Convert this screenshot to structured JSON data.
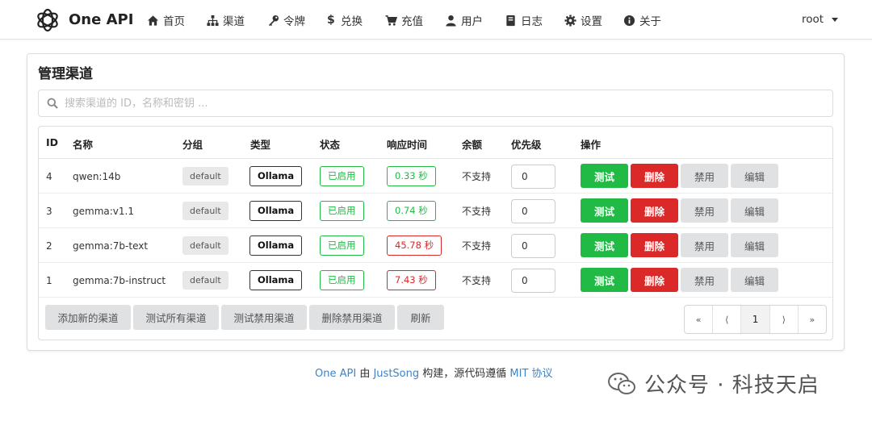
{
  "app": {
    "brand": "One API"
  },
  "nav": {
    "items": [
      {
        "label": "首页",
        "icon": "home-icon"
      },
      {
        "label": "渠道",
        "icon": "sitemap-icon"
      },
      {
        "label": "令牌",
        "icon": "key-icon"
      },
      {
        "label": "兑换",
        "icon": "dollar-icon"
      },
      {
        "label": "充值",
        "icon": "cart-icon"
      },
      {
        "label": "用户",
        "icon": "user-icon"
      },
      {
        "label": "日志",
        "icon": "book-icon"
      },
      {
        "label": "设置",
        "icon": "gear-icon"
      },
      {
        "label": "关于",
        "icon": "info-icon"
      }
    ],
    "user": "root"
  },
  "page": {
    "title": "管理渠道",
    "search_placeholder": "搜索渠道的 ID，名称和密钥 ..."
  },
  "table": {
    "headers": [
      "ID",
      "名称",
      "分组",
      "类型",
      "状态",
      "响应时间",
      "余额",
      "优先级",
      "操作"
    ],
    "rows": [
      {
        "id": "4",
        "name": "qwen:14b",
        "group": "default",
        "type": "Ollama",
        "status": "已启用",
        "response": "0.33 秒",
        "response_level": "ok",
        "balance": "不支持",
        "priority": "0"
      },
      {
        "id": "3",
        "name": "gemma:v1.1",
        "group": "default",
        "type": "Ollama",
        "status": "已启用",
        "response": "0.74 秒",
        "response_level": "ok",
        "balance": "不支持",
        "priority": "0"
      },
      {
        "id": "2",
        "name": "gemma:7b-text",
        "group": "default",
        "type": "Ollama",
        "status": "已启用",
        "response": "45.78 秒",
        "response_level": "slow",
        "balance": "不支持",
        "priority": "0"
      },
      {
        "id": "1",
        "name": "gemma:7b-instruct",
        "group": "default",
        "type": "Ollama",
        "status": "已启用",
        "response": "7.43 秒",
        "response_level": "slow",
        "balance": "不支持",
        "priority": "0"
      }
    ],
    "actions": {
      "test": "测试",
      "delete": "删除",
      "disable": "禁用",
      "edit": "编辑"
    }
  },
  "toolbar": {
    "add": "添加新的渠道",
    "test_all": "测试所有渠道",
    "test_disabled": "测试禁用渠道",
    "delete_disabled": "删除禁用渠道",
    "refresh": "刷新"
  },
  "pagination": {
    "first": "«",
    "prev": "⟨",
    "current": "1",
    "next": "⟩",
    "last": "»"
  },
  "footer": {
    "app": "One API",
    "by": "由",
    "author": "JustSong",
    "built": "构建，源代码遵循",
    "license": "MIT 协议"
  },
  "watermark": {
    "text": "公众号 · 科技天启"
  },
  "colors": {
    "green": "#21ba45",
    "red": "#db2828",
    "link": "#4183c4",
    "grey": "#e0e1e2"
  }
}
